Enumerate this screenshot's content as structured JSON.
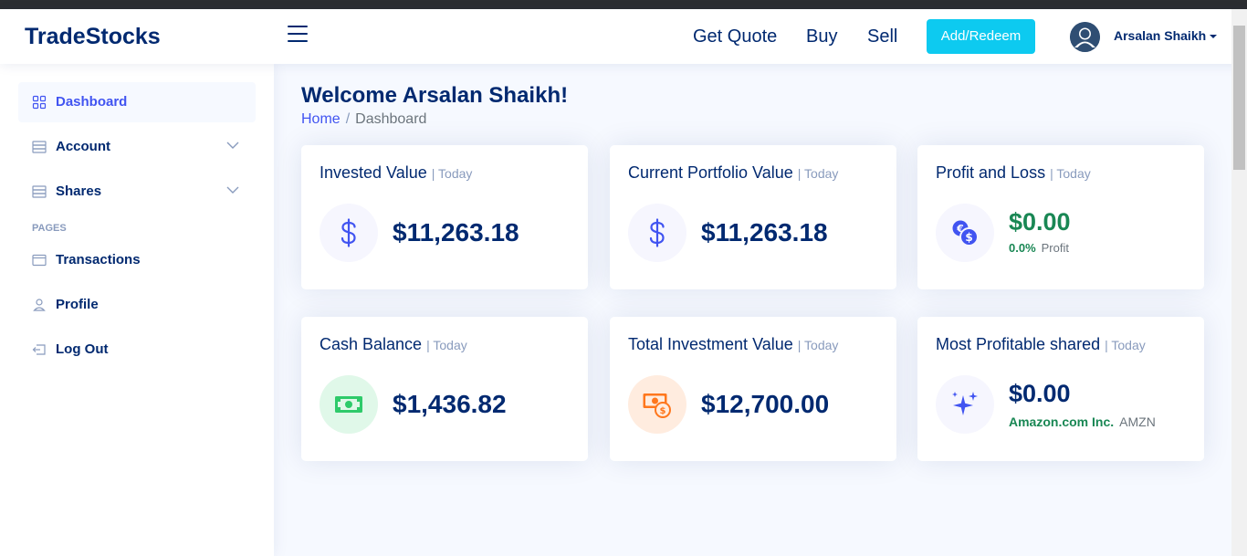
{
  "header": {
    "logo": "TradeStocks",
    "nav": [
      "Get Quote",
      "Buy",
      "Sell"
    ],
    "add_redeem": "Add/Redeem",
    "user_name": "Arsalan Shaikh"
  },
  "sidebar": {
    "items": [
      {
        "label": "Dashboard",
        "icon": "grid-icon"
      },
      {
        "label": "Account",
        "icon": "menu-icon"
      },
      {
        "label": "Shares",
        "icon": "menu-icon"
      }
    ],
    "pages_heading": "PAGES",
    "pages": [
      {
        "label": "Transactions",
        "icon": "card-icon"
      },
      {
        "label": "Profile",
        "icon": "person-icon"
      },
      {
        "label": "Log Out",
        "icon": "logout-icon"
      }
    ]
  },
  "main": {
    "title": "Welcome Arsalan Shaikh!",
    "breadcrumb": {
      "home": "Home",
      "separator": "/",
      "current": "Dashboard"
    }
  },
  "cards": {
    "today": "| Today",
    "invested": {
      "title": "Invested Value",
      "value": "$11,263.18",
      "icon": "dollar-icon"
    },
    "portfolio": {
      "title": "Current Portfolio Value",
      "value": "$11,263.18",
      "icon": "dollar-icon"
    },
    "profit_loss": {
      "title": "Profit and Loss",
      "value": "$0.00",
      "percent": "0.0%",
      "label": "Profit",
      "icon": "currency-exchange-icon"
    },
    "cash": {
      "title": "Cash Balance",
      "value": "$1,436.82",
      "icon": "cash-icon"
    },
    "total": {
      "title": "Total Investment Value",
      "value": "$12,700.00",
      "icon": "cash-coin-icon"
    },
    "most_profitable": {
      "title": "Most Profitable shared",
      "value": "$0.00",
      "company": "Amazon.com Inc.",
      "ticker": "AMZN",
      "icon": "stars-icon"
    }
  },
  "colors": {
    "primary": "#012970",
    "accent": "#4154f1",
    "add_button": "#0dcaf0",
    "profit_green": "#198754"
  }
}
